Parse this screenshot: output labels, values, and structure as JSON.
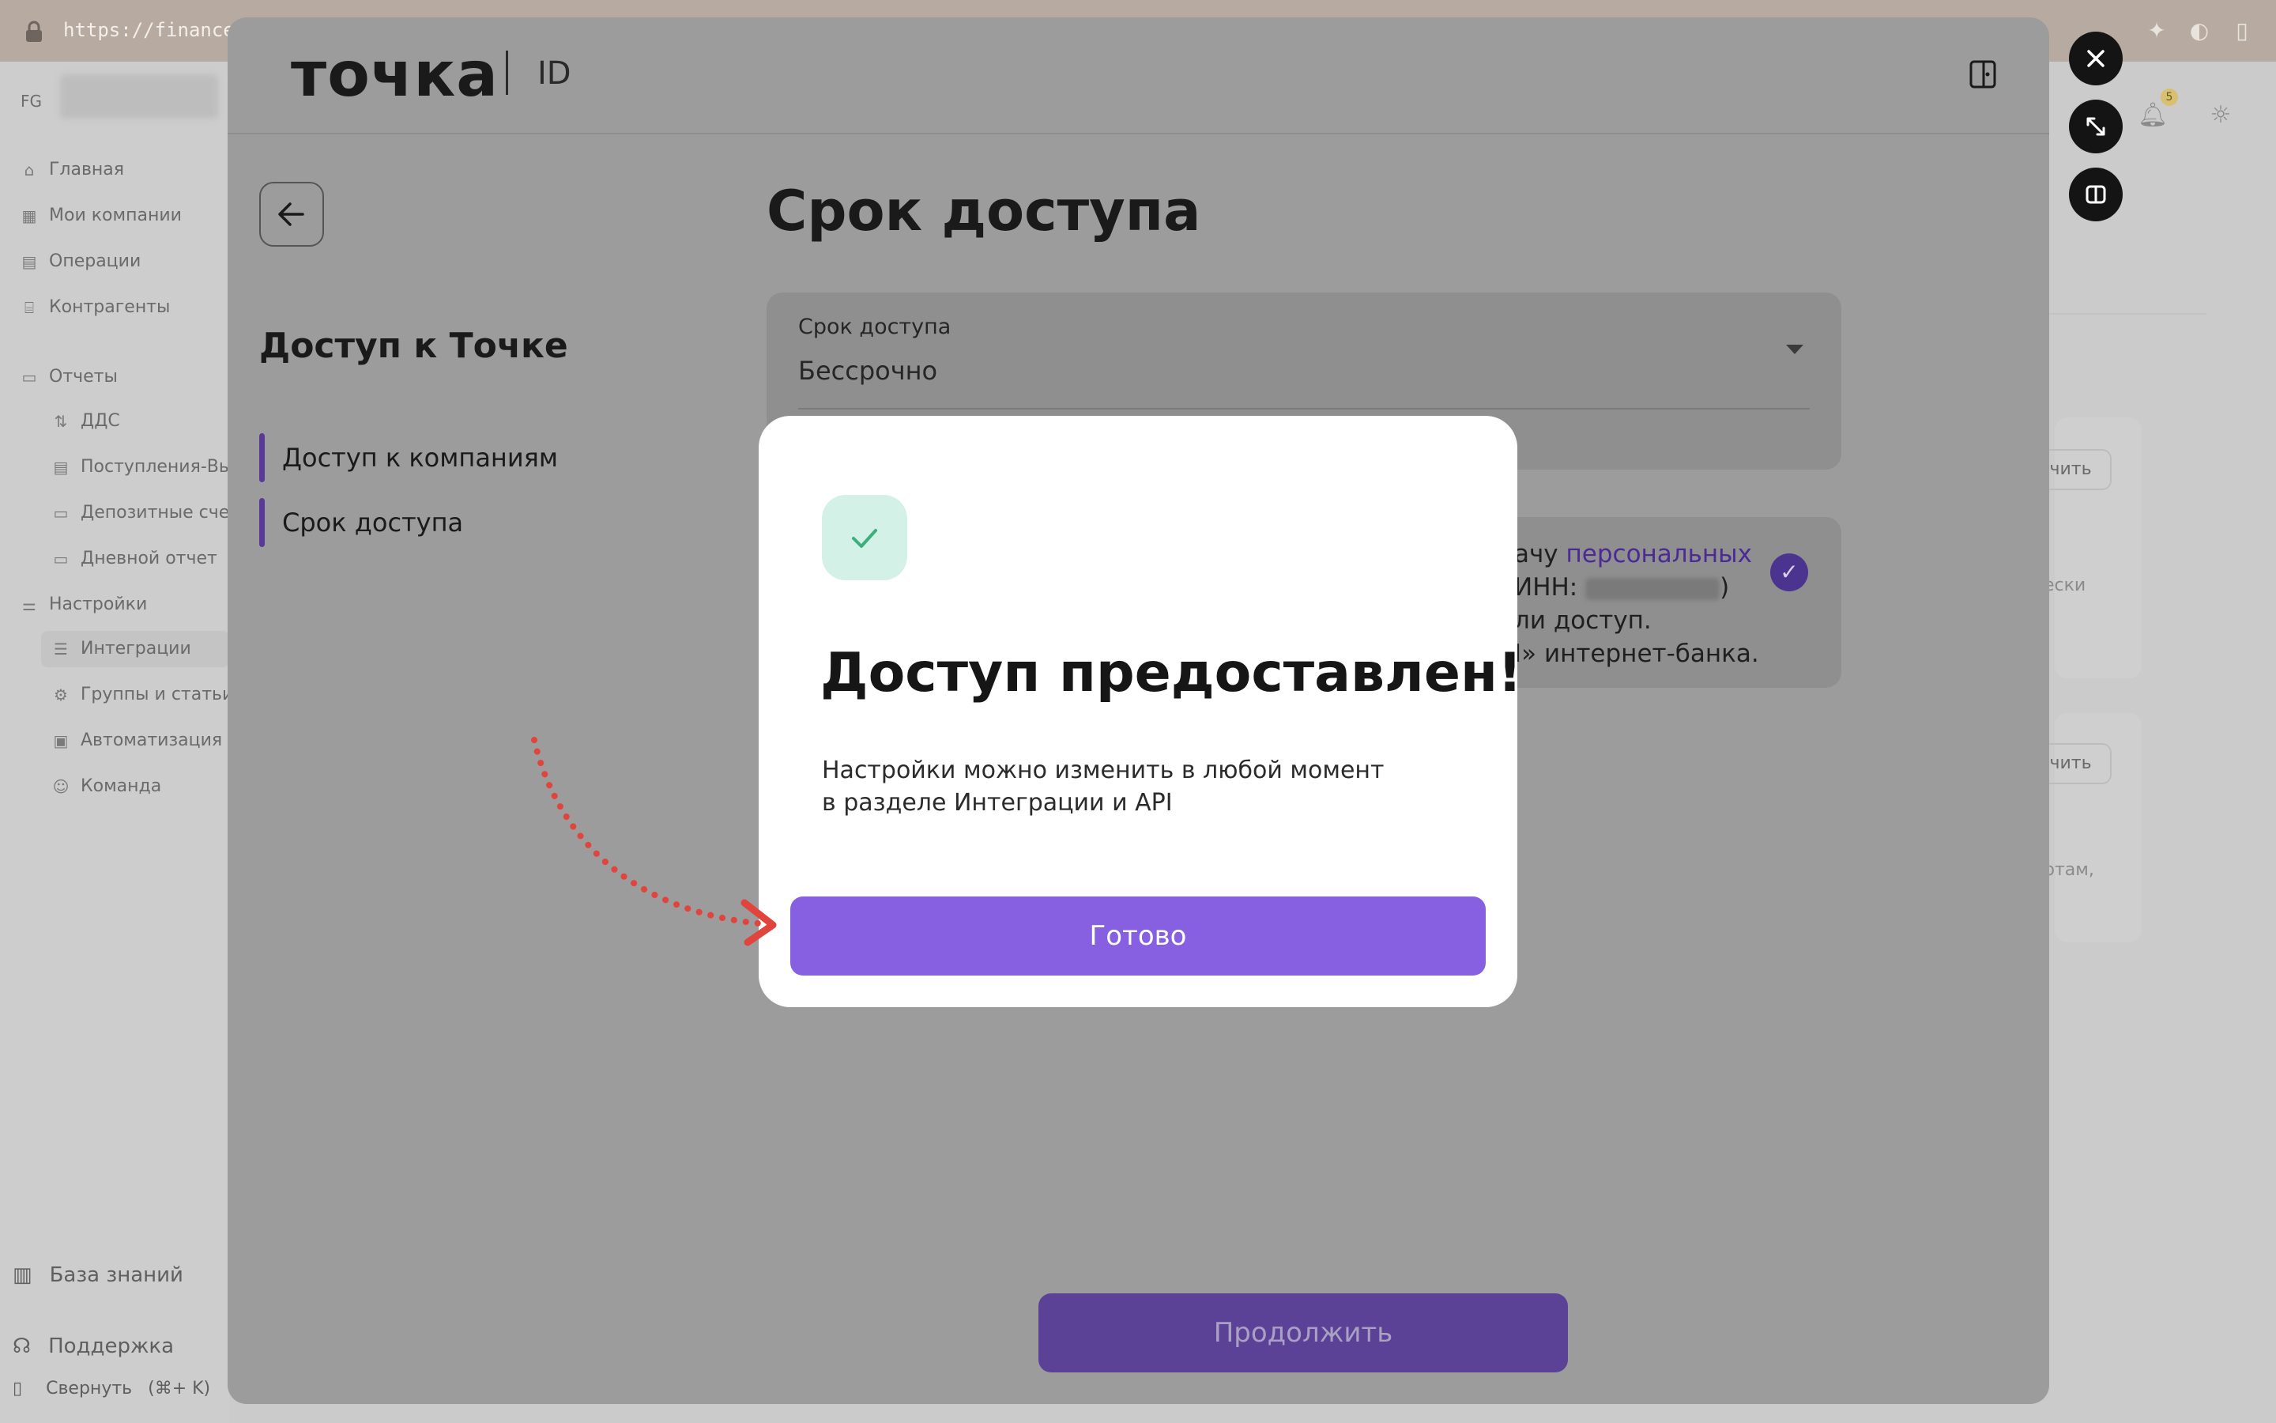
{
  "browser": {
    "url": "https://financeg"
  },
  "app": {
    "user_initials": "FG",
    "sidebar": {
      "items": [
        {
          "label": "Главная",
          "icon": "home-icon"
        },
        {
          "label": "Мои компании",
          "icon": "companies-icon"
        },
        {
          "label": "Операции",
          "icon": "operations-icon"
        },
        {
          "label": "Контрагенты",
          "icon": "bank-icon"
        },
        {
          "label": "Отчеты",
          "icon": "reports-icon"
        },
        {
          "label": "ДДС",
          "icon": "cashflow-icon"
        },
        {
          "label": "Поступления-Вы",
          "icon": "document-icon"
        },
        {
          "label": "Депозитные счет",
          "icon": "deposit-icon"
        },
        {
          "label": "Дневной отчет",
          "icon": "daily-report-icon"
        },
        {
          "label": "Настройки",
          "icon": "settings-sliders-icon"
        },
        {
          "label": "Интеграции",
          "icon": "integrations-icon"
        },
        {
          "label": "Группы и статьи",
          "icon": "gear-icon"
        },
        {
          "label": "Автоматизация п",
          "icon": "robot-icon"
        },
        {
          "label": "Команда",
          "icon": "team-icon"
        }
      ],
      "bottom": {
        "knowledge_base": "База знаний",
        "support": "Поддержка",
        "collapse": "Свернуть",
        "collapse_shortcut": "(⌘+ K)"
      }
    },
    "right_panel": {
      "card1_button": "чить",
      "card1_text": "ески",
      "card2_button": "чить",
      "card2_text": "ртам,"
    },
    "notification_count": "5"
  },
  "modal": {
    "logo": "точка",
    "logo_suffix": "ID",
    "left_title": "Доступ к Точке",
    "steps": [
      "Доступ к компаниям",
      "Срок доступа"
    ],
    "title": "Срок доступа",
    "field": {
      "label": "Срок доступа",
      "value": "Бессрочно"
    },
    "consent": {
      "line1_prefix": "ачу ",
      "line1_link": "персональных",
      "line2_prefix": "ИНН: ",
      "line2_suffix": ")",
      "line3": "ли доступ.",
      "line4": "I» интернет-банка."
    },
    "continue_label": "Продолжить"
  },
  "dialog": {
    "title": "Доступ предоставлен!",
    "text_line1": "Настройки можно изменить в любой момент",
    "text_line2": "в разделе Интеграции и API",
    "done_label": "Готово"
  },
  "colors": {
    "accent": "#8660e0",
    "success_bg": "#d3f1e6",
    "success_check": "#3dae7e",
    "annotation_arrow": "#e0443c"
  }
}
